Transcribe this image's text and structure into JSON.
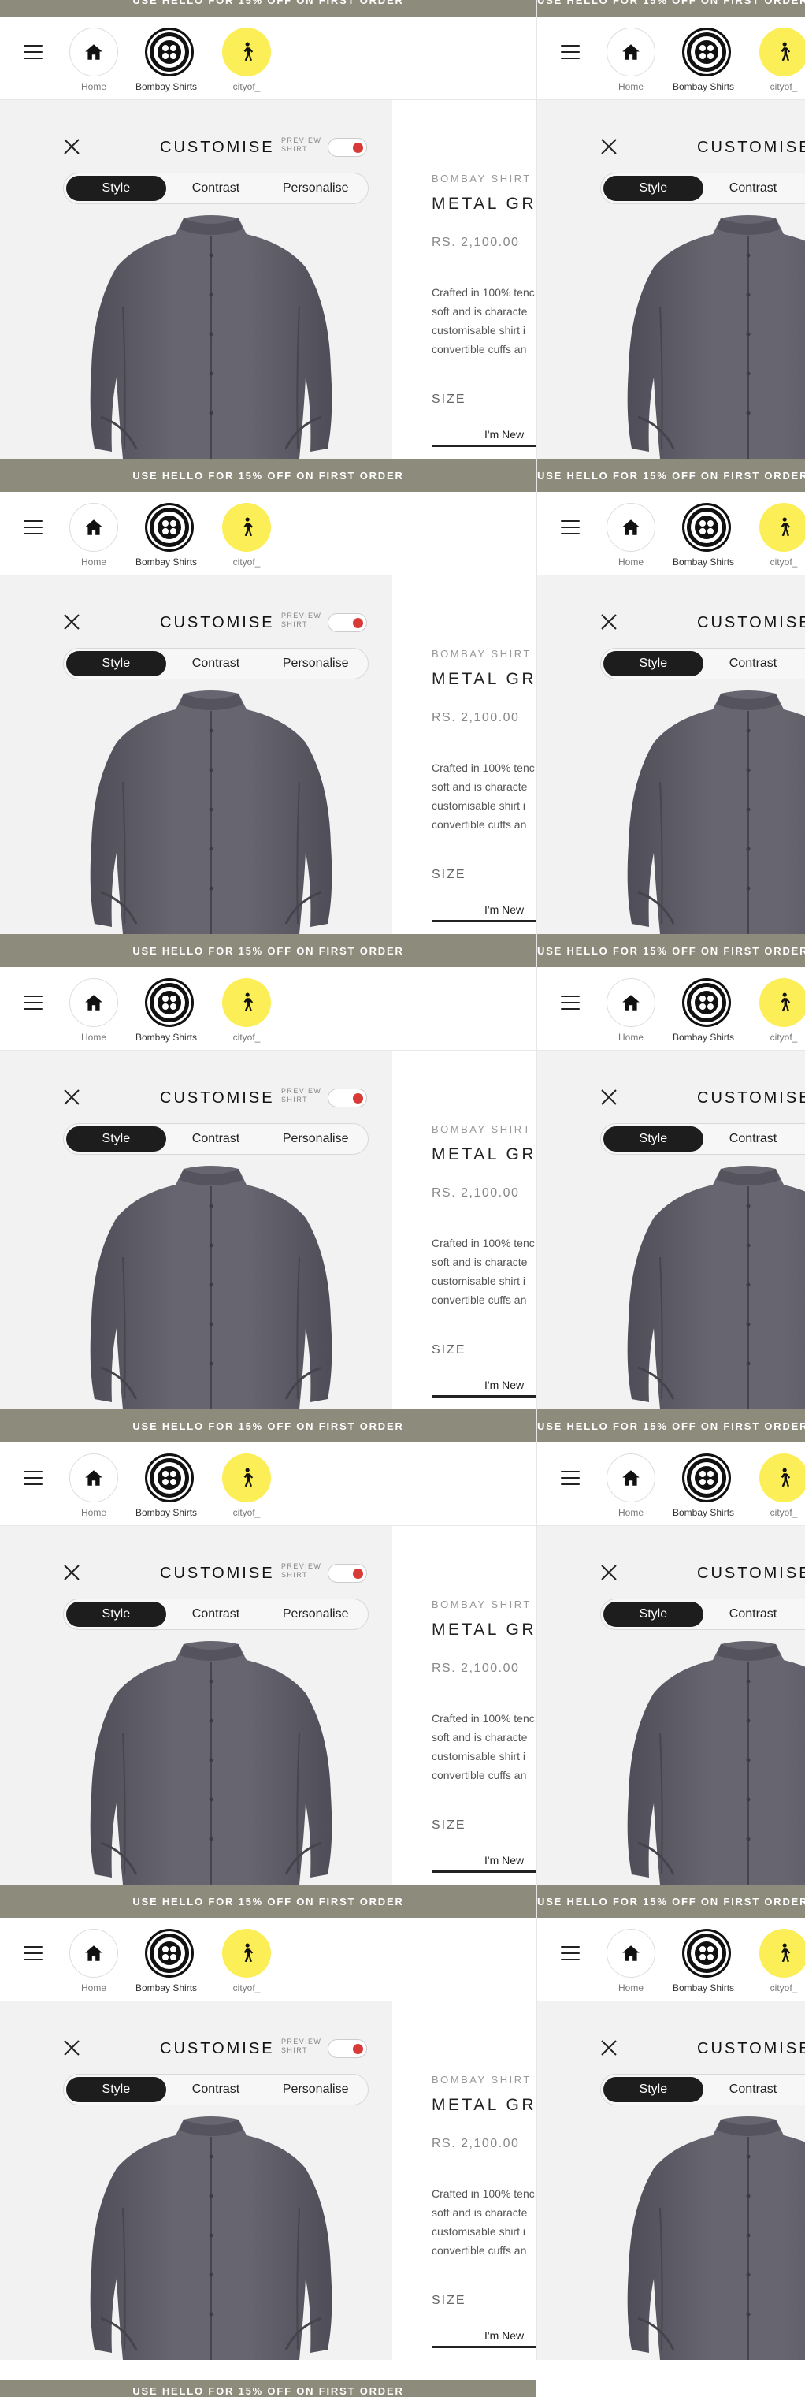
{
  "banner": {
    "text": "USE HELLO FOR 15% OFF ON FIRST ORDER"
  },
  "nav": {
    "items": [
      {
        "label": "Home",
        "icon": "home-icon"
      },
      {
        "label": "Bombay Shirts",
        "icon": "button-logo-icon"
      },
      {
        "label": "cityof_",
        "icon": "walking-person-icon"
      }
    ]
  },
  "customise": {
    "title": "CUSTOMISE",
    "preview_line1": "PREVIEW",
    "preview_line2": "SHIRT",
    "toggle_on": true,
    "tabs": [
      "Style",
      "Contrast",
      "Personalise"
    ],
    "active_tab": "Style"
  },
  "product": {
    "brand": "BOMBAY SHIRT C",
    "title": "METAL GRE",
    "price": "RS. 2,100.00",
    "description_lines": [
      "Crafted in 100% tenc",
      "soft and is characte",
      "customisable shirt i",
      "convertible cuffs an"
    ],
    "size_label": "SIZE",
    "size_option": "I'm New"
  },
  "colors": {
    "banner": "#8d8b7c",
    "city_yellow": "#fbee56",
    "toggle_red": "#d83a37",
    "shirt": "#5e5c66",
    "active_tab": "#1d1d1d"
  }
}
